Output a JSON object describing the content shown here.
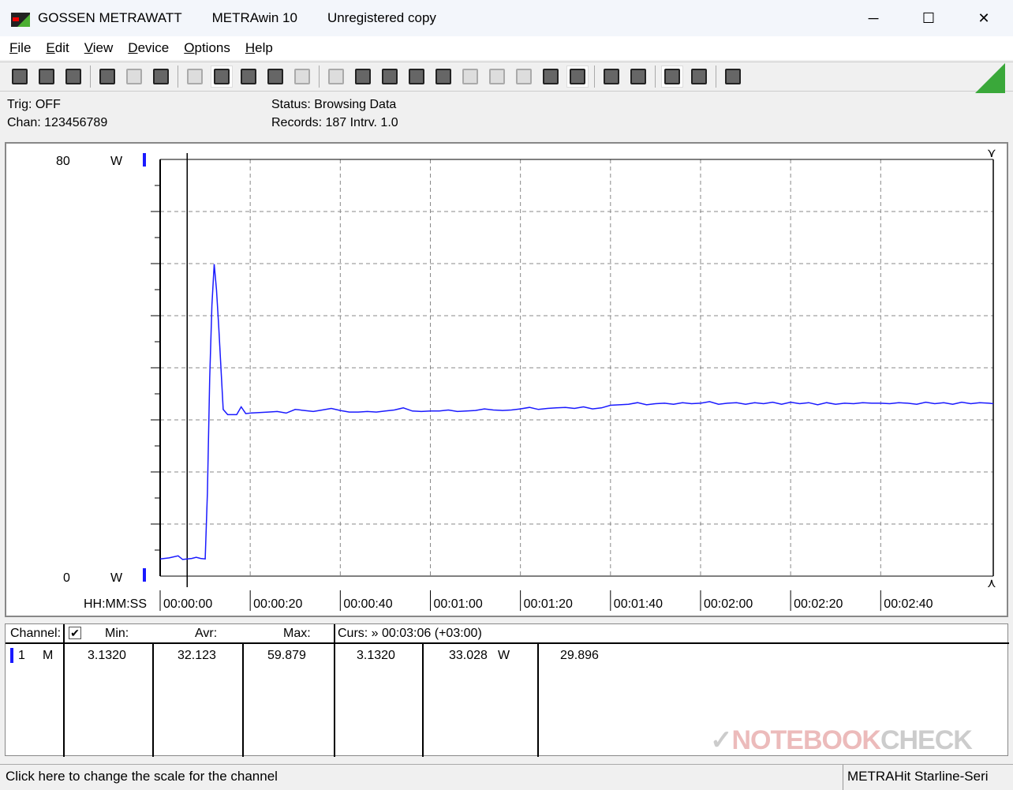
{
  "window": {
    "title_parts": [
      "GOSSEN METRAWATT",
      "METRAwin 10",
      "Unregistered copy"
    ],
    "minimize": "─",
    "maximize": "☐",
    "close": "✕"
  },
  "menu": [
    "File",
    "Edit",
    "View",
    "Device",
    "Options",
    "Help"
  ],
  "toolbar": [
    {
      "icon": "save-icon"
    },
    {
      "icon": "save-as-icon"
    },
    {
      "icon": "open-folder-icon"
    },
    null,
    {
      "icon": "device-read-icon"
    },
    {
      "icon": "device-transfer-icon",
      "disabled": true
    },
    {
      "icon": "memory-read-icon"
    },
    null,
    {
      "icon": "display-icon",
      "disabled": true
    },
    {
      "icon": "waveform-view-icon",
      "active": true
    },
    {
      "icon": "crosshair-icon"
    },
    {
      "icon": "table-view-icon"
    },
    {
      "icon": "histogram-icon",
      "disabled": true
    },
    null,
    {
      "icon": "export-icon",
      "disabled": true
    },
    {
      "icon": "import-icon"
    },
    {
      "icon": "settings-list-icon"
    },
    {
      "icon": "monitor-icon"
    },
    {
      "icon": "function-icon"
    },
    {
      "icon": "device-config-icon",
      "disabled": true
    },
    {
      "icon": "signal-icon",
      "disabled": true
    },
    {
      "icon": "pulse-icon",
      "disabled": true
    },
    {
      "icon": "clock-icon"
    },
    {
      "icon": "bug-icon",
      "active": true
    },
    null,
    {
      "icon": "print-preview-icon"
    },
    {
      "icon": "print-icon"
    },
    null,
    {
      "icon": "zoom-waveform-icon",
      "active": true
    },
    {
      "icon": "zoom-curve-icon"
    },
    null,
    {
      "icon": "comment-icon"
    }
  ],
  "info": {
    "trig": "Trig: OFF",
    "chan": "Chan:  123456789",
    "status": "Status:   Browsing Data",
    "records": "Records: 187   Intrv. 1.0"
  },
  "colors": {
    "series": "#1a1aff",
    "accent_green": "#3aa83a"
  },
  "chart_data": {
    "type": "line",
    "xlabel": "HH:MM:SS",
    "x_unit": "seconds",
    "xlim": [
      0,
      185
    ],
    "ylim": [
      0,
      80
    ],
    "y_unit": "W",
    "y_tick_labels": [
      "80",
      "0"
    ],
    "grid": true,
    "x_ticks": [
      {
        "t": 0,
        "label": "00:00:00"
      },
      {
        "t": 20,
        "label": "00:00:20"
      },
      {
        "t": 40,
        "label": "00:00:40"
      },
      {
        "t": 60,
        "label": "00:01:00"
      },
      {
        "t": 80,
        "label": "00:01:20"
      },
      {
        "t": 100,
        "label": "00:01:40"
      },
      {
        "t": 120,
        "label": "00:02:00"
      },
      {
        "t": 140,
        "label": "00:02:20"
      },
      {
        "t": 160,
        "label": "00:02:40"
      }
    ],
    "cursor_t": 6,
    "series": [
      {
        "points": [
          [
            0,
            3.3
          ],
          [
            2,
            3.5
          ],
          [
            4,
            3.9
          ],
          [
            5,
            3.2
          ],
          [
            7,
            3.4
          ],
          [
            8,
            3.6
          ],
          [
            9,
            3.4
          ],
          [
            10,
            3.3
          ],
          [
            10.5,
            16
          ],
          [
            11,
            38
          ],
          [
            11.5,
            52
          ],
          [
            12,
            59.9
          ],
          [
            12.5,
            55
          ],
          [
            13,
            48
          ],
          [
            14,
            32
          ],
          [
            15,
            31
          ],
          [
            16,
            31
          ],
          [
            17,
            31
          ],
          [
            18,
            32.5
          ],
          [
            19,
            31.2
          ],
          [
            20,
            31.3
          ],
          [
            22,
            31.4
          ],
          [
            24,
            31.5
          ],
          [
            26,
            31.6
          ],
          [
            28,
            31.3
          ],
          [
            30,
            32
          ],
          [
            32,
            31.8
          ],
          [
            34,
            31.6
          ],
          [
            36,
            31.9
          ],
          [
            38,
            32.2
          ],
          [
            40,
            31.8
          ],
          [
            42,
            31.5
          ],
          [
            44,
            31.5
          ],
          [
            46,
            31.6
          ],
          [
            48,
            31.5
          ],
          [
            50,
            31.7
          ],
          [
            52,
            31.9
          ],
          [
            54,
            32.3
          ],
          [
            56,
            31.7
          ],
          [
            58,
            31.6
          ],
          [
            60,
            31.7
          ],
          [
            62,
            31.7
          ],
          [
            64,
            31.9
          ],
          [
            66,
            31.6
          ],
          [
            68,
            31.7
          ],
          [
            70,
            31.8
          ],
          [
            72,
            32.1
          ],
          [
            74,
            31.9
          ],
          [
            76,
            31.8
          ],
          [
            78,
            31.9
          ],
          [
            80,
            32.1
          ],
          [
            82,
            32.4
          ],
          [
            84,
            32.0
          ],
          [
            86,
            32.2
          ],
          [
            88,
            32.3
          ],
          [
            90,
            32.4
          ],
          [
            92,
            32.2
          ],
          [
            94,
            32.5
          ],
          [
            96,
            32.1
          ],
          [
            98,
            32.3
          ],
          [
            100,
            32.8
          ],
          [
            102,
            32.9
          ],
          [
            104,
            33.0
          ],
          [
            106,
            33.3
          ],
          [
            108,
            32.9
          ],
          [
            110,
            33.1
          ],
          [
            112,
            33.2
          ],
          [
            114,
            33.0
          ],
          [
            116,
            33.3
          ],
          [
            118,
            33.1
          ],
          [
            120,
            33.2
          ],
          [
            122,
            33.5
          ],
          [
            124,
            33.0
          ],
          [
            126,
            33.2
          ],
          [
            128,
            33.3
          ],
          [
            130,
            33.0
          ],
          [
            132,
            33.3
          ],
          [
            134,
            33.1
          ],
          [
            136,
            33.4
          ],
          [
            138,
            33.0
          ],
          [
            140,
            33.4
          ],
          [
            142,
            33.1
          ],
          [
            144,
            33.3
          ],
          [
            146,
            32.9
          ],
          [
            148,
            33.3
          ],
          [
            150,
            33.0
          ],
          [
            152,
            33.2
          ],
          [
            154,
            33.1
          ],
          [
            156,
            33.3
          ],
          [
            158,
            33.2
          ],
          [
            160,
            33.2
          ],
          [
            162,
            33.1
          ],
          [
            164,
            33.3
          ],
          [
            166,
            33.2
          ],
          [
            168,
            33.0
          ],
          [
            170,
            33.4
          ],
          [
            172,
            33.1
          ],
          [
            174,
            33.3
          ],
          [
            176,
            33.0
          ],
          [
            178,
            33.4
          ],
          [
            180,
            33.1
          ],
          [
            182,
            33.3
          ],
          [
            184,
            33.2
          ],
          [
            185,
            33.1
          ]
        ]
      }
    ]
  },
  "table": {
    "headers": {
      "channel": "Channel:",
      "min": "Min:",
      "avr": "Avr:",
      "max": "Max:",
      "curs": "Curs: » 00:03:06 (+03:00)"
    },
    "row": {
      "num": "1",
      "mode": "M",
      "min": "3.1320",
      "avr": "32.123",
      "max": "59.879",
      "curs_val": "3.1320",
      "val": "33.028",
      "unit": "W",
      "val2": "29.896"
    }
  },
  "statusbar": {
    "hint": "Click here to change the scale for the channel",
    "device": "METRAHit Starline-Seri"
  },
  "watermark": "NOTEBOOKCHECK"
}
